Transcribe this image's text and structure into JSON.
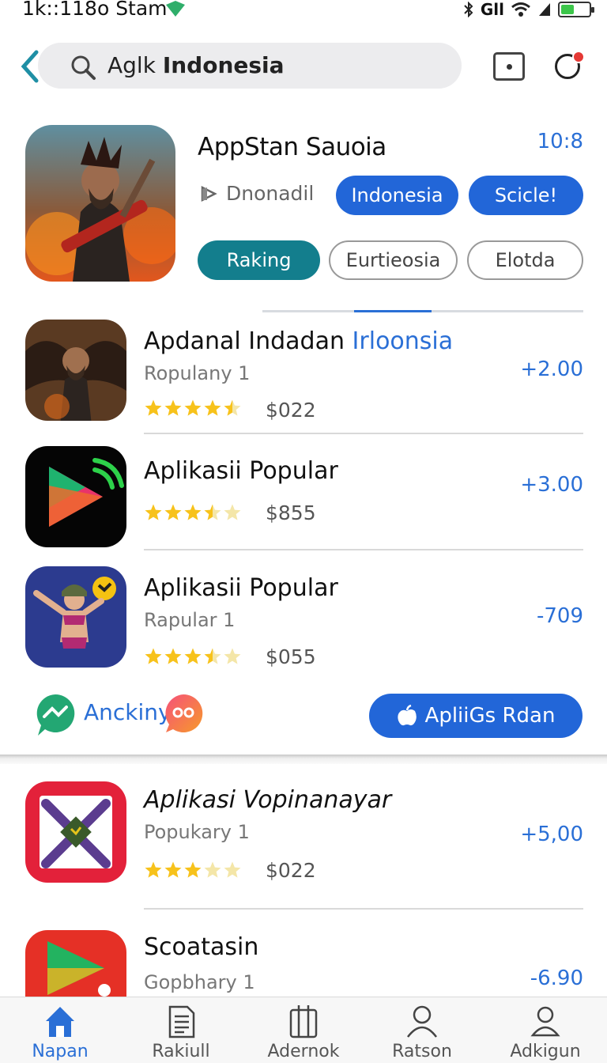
{
  "status_bar": {
    "time": "1k::118o Stam",
    "signal": "Gll"
  },
  "search": {
    "query_prefix": "Aglk",
    "query_bold": "Indonesia"
  },
  "featured": {
    "title": "AppStan Sauoia",
    "meta": "10:8",
    "download_label": "Dnonadil",
    "tags": [
      "Indonesia",
      "Scicle!"
    ],
    "chips": [
      "Raking",
      "Eurtieosia",
      "Elotda"
    ]
  },
  "apps": [
    {
      "title": "Apdanal Indadan",
      "title_highlight": "Irloonsia",
      "subtitle": "Ropulany 1",
      "rating": 4.5,
      "price": "$022",
      "delta": "+2.00"
    },
    {
      "title": "Aplikasii Popular",
      "title_highlight": "",
      "subtitle": "",
      "rating": 3.5,
      "price": "$855",
      "delta": "+3.00"
    },
    {
      "title": "Aplikasii Popular",
      "title_highlight": "",
      "subtitle": "Rapular 1",
      "rating": 3.5,
      "price": "$055",
      "delta": "-709"
    },
    {
      "title": "Aplikasi Vopinanayar",
      "title_highlight": "",
      "subtitle": "Popukary 1",
      "rating": 3,
      "price": "$022",
      "delta": "+5,00"
    },
    {
      "title": "Scoatasin",
      "title_highlight": "",
      "subtitle": "Gopbhary 1",
      "rating": 0,
      "price": "",
      "delta": "-6.90"
    }
  ],
  "action_strip": {
    "label": "Anckiny",
    "cta_label": "ApliiGs Rdan"
  },
  "nav": [
    {
      "label": "Napan",
      "icon": "home-icon",
      "active": true
    },
    {
      "label": "Rakiull",
      "icon": "document-icon",
      "active": false
    },
    {
      "label": "Adernok",
      "icon": "book-icon",
      "active": false
    },
    {
      "label": "Ratson",
      "icon": "person-icon",
      "active": false
    },
    {
      "label": "Adkigun",
      "icon": "account-icon",
      "active": false
    }
  ],
  "colors": {
    "accent": "#2266d8",
    "teal": "#137e8d",
    "link": "#2a6fd6",
    "star": "#f7c21b"
  }
}
